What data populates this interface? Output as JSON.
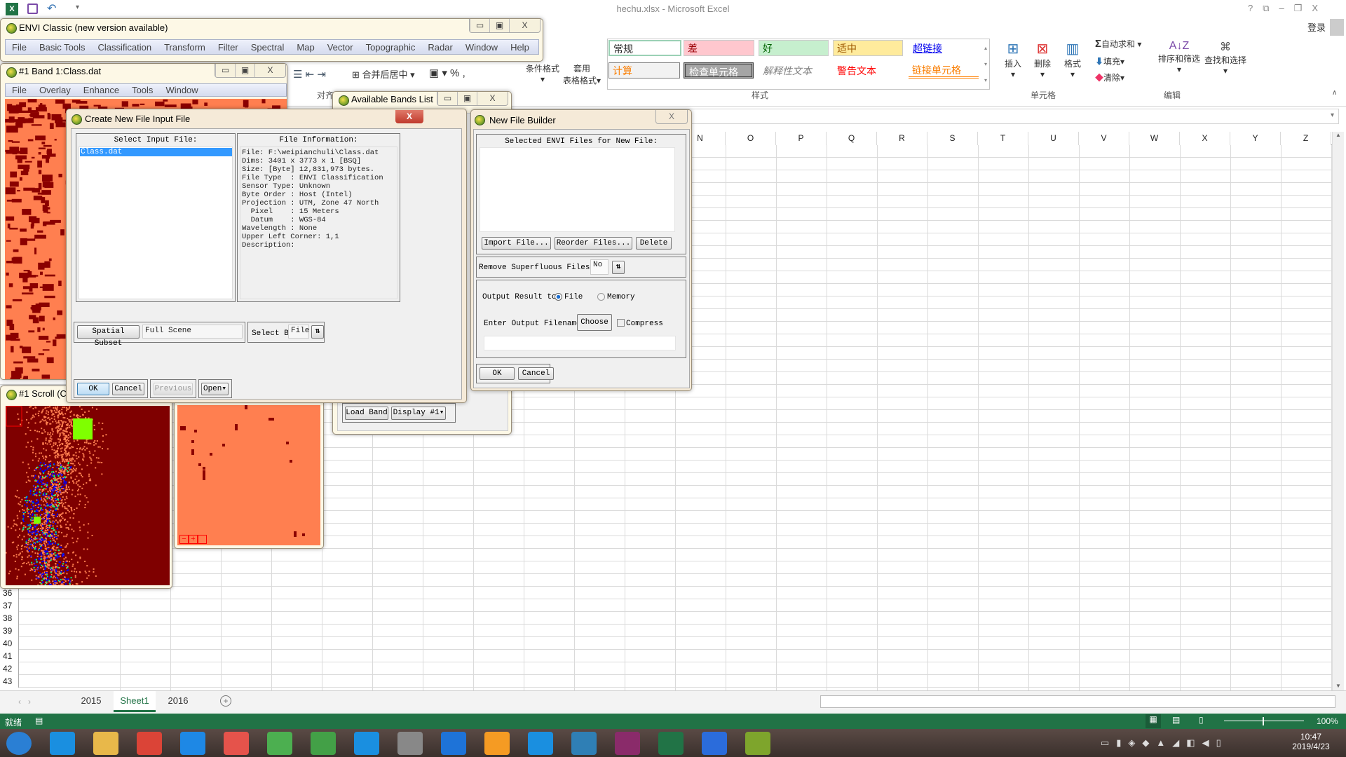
{
  "excel": {
    "title": "hechu.xlsx - Microsoft Excel",
    "signin": "登录",
    "title_controls": [
      "?",
      "⧉",
      "–",
      "❐",
      "X"
    ],
    "ribbon": {
      "merge": "合并后居中",
      "percent": "%",
      "comma": ",",
      "cond_format": "条件格式",
      "table_format_1": "套用",
      "table_format_2": "表格格式",
      "styles": {
        "normal": "常规",
        "bad": "差",
        "good": "好",
        "neutral": "适中",
        "hyperlink": "超链接",
        "calc": "计算",
        "check": "检查单元格",
        "explanatory": "解释性文本",
        "warning": "警告文本",
        "linked": "链接单元格"
      },
      "insert": "插入",
      "delete": "删除",
      "format": "格式",
      "autosum": "自动求和",
      "fill": "填充",
      "clear": "清除",
      "sort_filter": "排序和筛选",
      "find_select": "查找和选择",
      "groups": {
        "align": "对齐",
        "styles": "样式",
        "cells": "单元格",
        "editing": "编辑"
      }
    },
    "columns": [
      "N",
      "O",
      "P",
      "Q",
      "R",
      "S",
      "T",
      "U",
      "V",
      "W",
      "X",
      "Y",
      "Z"
    ],
    "rows": [
      "36",
      "37",
      "38",
      "39",
      "40",
      "41",
      "42",
      "43"
    ],
    "sheet_tabs": [
      {
        "label": "2015",
        "active": false
      },
      {
        "label": "Sheet1",
        "active": true
      },
      {
        "label": "2016",
        "active": false
      }
    ],
    "status": {
      "ready": "就绪",
      "zoom": "100%"
    },
    "accent": "#217346"
  },
  "envi": {
    "main_title": "ENVI Classic (new version available)",
    "main_menu": [
      "File",
      "Basic Tools",
      "Classification",
      "Transform",
      "Filter",
      "Spectral",
      "Map",
      "Vector",
      "Topographic",
      "Radar",
      "Window",
      "Help"
    ],
    "band_window": {
      "title": "#1 Band 1:Class.dat",
      "menu": [
        "File",
        "Overlay",
        "Enhance",
        "Tools",
        "Window"
      ]
    },
    "scroll_window": {
      "title": "#1 Scroll (C"
    },
    "bands_list": {
      "title": "Available Bands List",
      "load_band": "Load Band",
      "display": "Display #1"
    },
    "input_dialog": {
      "title": "Create New File Input File",
      "select_label": "Select Input File:",
      "files": [
        "Class.dat"
      ],
      "info_label": "File Information:",
      "info_lines": [
        "File: F:\\weipianchuli\\Class.dat",
        "Dims: 3401 x 3773 x 1 [BSQ]",
        "Size: [Byte] 12,831,973 bytes.",
        "File Type  : ENVI Classification",
        "Sensor Type: Unknown",
        "Byte Order : Host (Intel)",
        "Projection : UTM, Zone 47 North",
        "  Pixel    : 15 Meters",
        "  Datum    : WGS-84",
        "Wavelength : None",
        "Upper Left Corner: 1,1",
        "Description:"
      ],
      "spatial_subset": "Spatial Subset",
      "subset_value": "Full Scene",
      "select_by": "Select By",
      "select_by_value": "File",
      "ok": "OK",
      "cancel": "Cancel",
      "previous": "Previous",
      "open": "Open"
    },
    "builder": {
      "title": "New File Builder",
      "list_label": "Selected ENVI Files for New File:",
      "import": "Import File...",
      "reorder": "Reorder Files...",
      "delete": "Delete",
      "remove_label": "Remove Superfluous Files ?",
      "remove_value": "No",
      "output_label": "Output Result to",
      "opt_file": "File",
      "opt_memory": "Memory",
      "selected_output": "File",
      "filename_label": "Enter Output Filename",
      "choose": "Choose",
      "compress": "Compress",
      "compress_checked": false,
      "filename_value": "",
      "ok": "OK",
      "cancel": "Cancel"
    }
  },
  "taskbar": {
    "apps": [
      "start",
      "ie",
      "explorer",
      "chrome",
      "qq-browser",
      "baidu-netdisk",
      "app-grid",
      "360-browser",
      "ie",
      "media",
      "b-app",
      "uc-browser",
      "edge",
      "app-blue",
      "winrar",
      "excel",
      "wps",
      "envi"
    ],
    "time": "10:47",
    "date": "2019/4/23"
  }
}
